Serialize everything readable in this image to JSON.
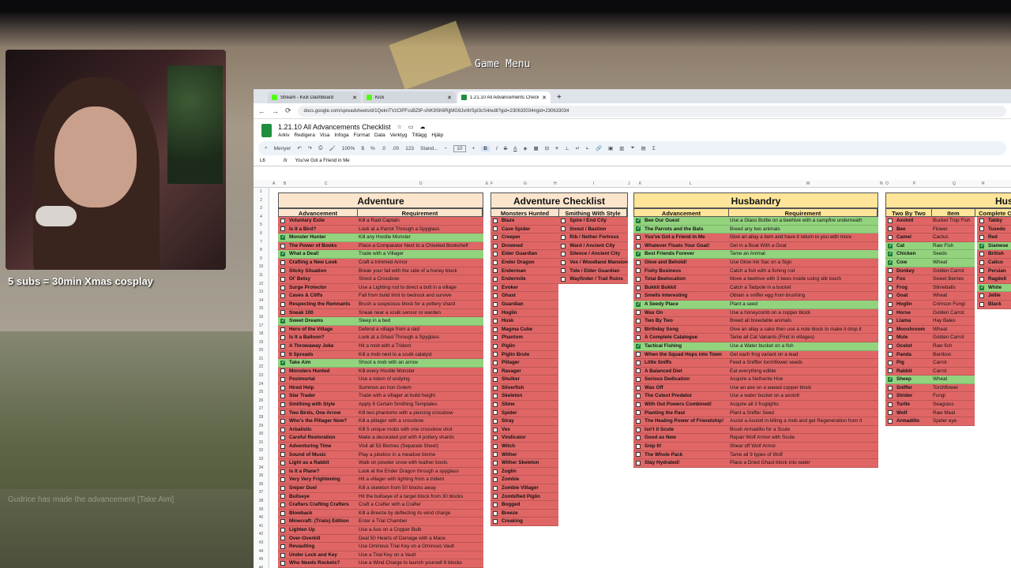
{
  "overlay": {
    "game_menu": "Game Menu",
    "cosplay": "5 subs = 30min Xmas cosplay",
    "chat": "Gudrice has made the advancement [Take Aim]"
  },
  "browser": {
    "tabs": [
      {
        "label": "Stream - Kick Dashboard"
      },
      {
        "label": "Kick"
      },
      {
        "label": "1.21.10 All Advancements Checklist"
      }
    ],
    "new_tab": "+",
    "url": "docs.google.com/spreadsheets/d/1QeknTVzClPFssBZtP-sNK9SK6RjjMG9Jvr8rSpI3cS4/edit?gid=230633034#gid=230633034"
  },
  "doc": {
    "title": "1.21.10 All Advancements Checklist",
    "menus": [
      "Arkiv",
      "Redigera",
      "Visa",
      "Infoga",
      "Format",
      "Data",
      "Verktyg",
      "Tillägg",
      "Hjälp"
    ],
    "toolbar": {
      "menus": "Menyer",
      "zoom": "100%",
      "currency": "$",
      "percent": "%",
      "decimals": ".0",
      "decimals2": ".00",
      "num123": "123",
      "font": "Stand...",
      "fontsize": "10",
      "bold": "B",
      "italic": "I",
      "strike": "S",
      "textcolor": "A"
    },
    "formula": {
      "cell": "L6",
      "value": "You've Got a Friend in Me"
    }
  },
  "columns": [
    "A",
    "B",
    "C",
    "D",
    "E",
    "F",
    "G",
    "H",
    "I",
    "J",
    "K",
    "L",
    "M",
    "N",
    "O",
    "P",
    "Q",
    "R"
  ],
  "rows": [
    "1",
    "2",
    "3",
    "4",
    "5",
    "6",
    "7",
    "8",
    "9",
    "10",
    "11",
    "12",
    "13",
    "14",
    "15",
    "16",
    "17",
    "18",
    "19",
    "20",
    "21",
    "22",
    "23",
    "24",
    "25",
    "26",
    "27",
    "28",
    "29",
    "30",
    "31",
    "32",
    "33",
    "34",
    "35",
    "36",
    "37",
    "38",
    "39",
    "40",
    "41",
    "42",
    "43",
    "44",
    "45",
    "46"
  ],
  "adventure": {
    "title": "Adventure",
    "h1": "Advancement",
    "h2": "Requirement",
    "rows": [
      [
        "Voluntary Exile",
        "Kill a Raid Captain",
        false
      ],
      [
        "Is It a Bird?",
        "Look at a Parrot Through a Spyglass",
        false
      ],
      [
        "Monster Hunter",
        "Kill any Hostile Monster",
        true
      ],
      [
        "The Power of Books",
        "Place a Comparator Next to a Chiseled Bookshelf",
        false
      ],
      [
        "What a Deal!",
        "Trade with a Villager",
        true
      ],
      [
        "Crafting a New Look",
        "Craft a trimmed Armor",
        false
      ],
      [
        "Sticky Situation",
        "Break your fall with the side of a honey block",
        false
      ],
      [
        "Ol' Betsy",
        "Shoot a Crossbow",
        false
      ],
      [
        "Surge Protector",
        "Use a Lighting rod to direct a bolt in a village",
        false
      ],
      [
        "Caves & Cliffs",
        "Fall from build limit to bedrock and survive",
        false
      ],
      [
        "Respecting the Remnants",
        "Brush a suspicious block for a pottery shard",
        false
      ],
      [
        "Sneak 100",
        "Sneak near a sculk sensor or warden",
        false
      ],
      [
        "Sweet Dreams",
        "Sleep in a bed",
        true
      ],
      [
        "Hero of the Village",
        "Defend a village from a raid",
        false
      ],
      [
        "Is It a Balloon?",
        "Look at a Ghast Through a Spyglass",
        false
      ],
      [
        "A Throwaway Joke",
        "Hit a mob with a Trident",
        false
      ],
      [
        "It Spreads",
        "Kill a mob next to a sculk catalyst",
        false
      ],
      [
        "Take Aim",
        "Shoot a mob with an arrow",
        true
      ],
      [
        "Monsters Hunted",
        "Kill every Hostile Monster",
        false
      ],
      [
        "Postmortal",
        "Use a totem of undying",
        false
      ],
      [
        "Hired Help",
        "Summon an Iron Golem",
        false
      ],
      [
        "Star Trader",
        "Trade with a villager at build height",
        false
      ],
      [
        "Smithing with Style",
        "Apply 8 Certain Smithing Templates",
        false
      ],
      [
        "Two Birds, One Arrow",
        "Kill two phantoms with a piercing crossbow",
        false
      ],
      [
        "Who's the Pillager Now?",
        "Kill a pillager with a crossbow",
        false
      ],
      [
        "Arbalistic",
        "Kill 5 unique mobs with one crossbow shot",
        false
      ],
      [
        "Careful Restoration",
        "Make a decorated pot with 4 pottery shards",
        false
      ],
      [
        "Adventuring Time",
        "Visit all 53 Biomes (Separate Sheet)",
        false
      ],
      [
        "Sound of Music",
        "Play a jukebox in a meadow biome",
        false
      ],
      [
        "Light as a Rabbit",
        "Walk on powder snow with leather boots",
        false
      ],
      [
        "Is It a Plane?",
        "Look at the Ender Dragon through a spyglass",
        false
      ],
      [
        "Very Very Frightening",
        "Hit a villager with lighting from a trident",
        false
      ],
      [
        "Sniper Duel",
        "Kill a skeleton from 50 blocks away",
        false
      ],
      [
        "Bullseye",
        "Hit the bullseye of a target block from 30 blocks",
        false
      ],
      [
        "Crafters Crafting Crafters",
        "Craft a Crafter with a Crafter",
        false
      ],
      [
        "Blowback",
        "Kill a Breeze by deflecting its wind charge",
        false
      ],
      [
        "Minecraft: (Trials) Edition",
        "Enter a Trial Chamber",
        false
      ],
      [
        "Lighten Up",
        "Use a Axe on a Copper Bulb",
        false
      ],
      [
        "Over-Overkill",
        "Deal 50 Hearts of Damage with a Mace",
        false
      ],
      [
        "Revaulting",
        "Use Ominous Trial Key on a Ominous Vault",
        false
      ],
      [
        "Under Lock and Key",
        "Use a Trial Key on a Vault",
        false
      ],
      [
        "Who Needs Rockets?",
        "Use a Wind Charge to launch yourself 8 blocks",
        false
      ]
    ]
  },
  "adventure_checklist": {
    "title": "Adventure Checklist",
    "h1": "Monsters Hunted",
    "h2": "Smithing With Style",
    "monsters": [
      "Blaze",
      "Cave Spider",
      "Creeper",
      "Drowned",
      "Elder Guardian",
      "Ender Dragon",
      "Enderman",
      "Endermite",
      "Evoker",
      "Ghast",
      "Guardian",
      "Hoglin",
      "Husk",
      "Magma Cube",
      "Phantom",
      "Piglin",
      "Piglin Brute",
      "Pillager",
      "Ravager",
      "Shulker",
      "Silverfish",
      "Skeleton",
      "Slime",
      "Spider",
      "Stray",
      "Vex",
      "Vindicator",
      "Witch",
      "Wither",
      "Wither Skeleton",
      "Zoglin",
      "Zombie",
      "Zombie Villager",
      "Zombified Piglin",
      "Bogged",
      "Breeze",
      "Creaking"
    ],
    "smithing": [
      "Spire / End City",
      "Snout / Bastion",
      "Rib / Nether Fortress",
      "Ward / Ancient City",
      "Silence / Ancient City",
      "Vex / Woodland Mansion",
      "Tide / Elder Guardian",
      "Wayfinder / Trail Ruins"
    ]
  },
  "husbandry": {
    "title": "Husbandry",
    "h1": "Advancement",
    "h2": "Requirement",
    "rows": [
      [
        "Bee Our Guest",
        "Use a Glass Bottle on a beehive with a campfire underneath",
        true
      ],
      [
        "The Parrots and the Bats",
        "Breed any two animals",
        true
      ],
      [
        "You've Got a Friend in Me",
        "Give an allay a item and have it return to you with more",
        false
      ],
      [
        "Whatever Floats Your Goat!",
        "Get in a Boat With a Goat",
        false
      ],
      [
        "Best Friends Forever",
        "Tame an Animal",
        true
      ],
      [
        "Glow and Behold!",
        "Use Glow Ink Sac on a Sign",
        false
      ],
      [
        "Fishy Business",
        "Catch a fish with a fishing rod",
        false
      ],
      [
        "Total Beelocation",
        "Move a beehive with 3 bees inside using silk touch",
        false
      ],
      [
        "Bukkit Bukkit",
        "Catch a Tadpole in a bucket",
        false
      ],
      [
        "Smells Interesting",
        "Obtain a sniffer egg from brushing",
        false
      ],
      [
        "A Seedy Place",
        "Plant a seed",
        true
      ],
      [
        "Wax On",
        "Use a honeycomb on a copper block",
        false
      ],
      [
        "Two By Two",
        "Breed all breedable animals",
        false
      ],
      [
        "Birthday Song",
        "Give an allay a cake then use a note block to make it drop it",
        false
      ],
      [
        "A Complete Catalogue",
        "Tame all Cat Variants (Find in villages)",
        false
      ],
      [
        "Tactical Fishing",
        "Use a Water bucket on a fish",
        true
      ],
      [
        "When the Squad Hops into Town",
        "Get each frog variant on a lead",
        false
      ],
      [
        "Little Sniffs",
        "Feed a Sniffler torchflower seeds",
        false
      ],
      [
        "A Balanced Diet",
        "Eat everything edible",
        false
      ],
      [
        "Serious Dedication",
        "Acquire a Netherite Hoe",
        false
      ],
      [
        "Wax Off",
        "Use an axe on a waxed copper block",
        false
      ],
      [
        "The Cutest Predator",
        "Use a water bucket on a axolotl",
        false
      ],
      [
        "With Out Powers Combined!",
        "Acquire all 3 froglights",
        false
      ],
      [
        "Planting the Past",
        "Plant a Sniffer Seed",
        false
      ],
      [
        "The Healing Power of Friendship!",
        "Assist a Axolotl in killing a mob and get Regeneration from it",
        false
      ],
      [
        "Isn't it Scute",
        "Brush Armadillo for a Scute",
        false
      ],
      [
        "Good as New",
        "Repair Wolf Armor with Scute",
        false
      ],
      [
        "Snip It!",
        "Shear off Wolf Armor",
        false
      ],
      [
        "The Whole Pack",
        "Tame all 9 types of Wolf",
        false
      ],
      [
        "Stay Hydrated!",
        "Place a Dried Ghast block into water",
        false
      ]
    ]
  },
  "husbandry2": {
    "title": "Husb",
    "h1": "Two By Two",
    "h2": "Item",
    "h3": "Complete Ca",
    "animals": [
      [
        "Axolotl",
        "Bucket Trop Fish",
        false
      ],
      [
        "Bee",
        "Flower",
        false
      ],
      [
        "Camel",
        "Cactus",
        false
      ],
      [
        "Cat",
        "Raw Fish",
        true
      ],
      [
        "Chicken",
        "Seeds",
        true
      ],
      [
        "Cow",
        "Wheat",
        true
      ],
      [
        "Donkey",
        "Golden Carrot",
        false
      ],
      [
        "Fox",
        "Sweet Berries",
        false
      ],
      [
        "Frog",
        "Slimeballs",
        false
      ],
      [
        "Goat",
        "Wheat",
        false
      ],
      [
        "Hoglin",
        "Crimson Fungi",
        false
      ],
      [
        "Horse",
        "Golden Carrot",
        false
      ],
      [
        "Llama",
        "Hay Bales",
        false
      ],
      [
        "Mooshroom",
        "Wheat",
        false
      ],
      [
        "Mule",
        "Golden Carrot",
        false
      ],
      [
        "Ocelot",
        "Raw fish",
        false
      ],
      [
        "Panda",
        "Bamboo",
        false
      ],
      [
        "Pig",
        "Carrot",
        false
      ],
      [
        "Rabbit",
        "Carrot",
        false
      ],
      [
        "Sheep",
        "Wheat",
        true
      ],
      [
        "Sniffer",
        "Torchflower",
        false
      ],
      [
        "Strider",
        "Fungi",
        false
      ],
      [
        "Turtle",
        "Seagrass",
        false
      ],
      [
        "Wolf",
        "Raw Meat",
        false
      ],
      [
        "Armadillo",
        "Spider eye",
        false
      ]
    ],
    "cats": [
      [
        "Tabby",
        false
      ],
      [
        "Tuxedo",
        false
      ],
      [
        "Red",
        false
      ],
      [
        "Siamese",
        true
      ],
      [
        "British",
        false
      ],
      [
        "Calico",
        false
      ],
      [
        "Persian",
        false
      ],
      [
        "Ragdoll",
        false
      ],
      [
        "White",
        true
      ],
      [
        "Jellie",
        false
      ],
      [
        "Black",
        false
      ]
    ]
  },
  "colors": {
    "red": "#e06666",
    "green": "#93d37e",
    "adventure_header": "#fce5cd",
    "husbandry_header": "#ffe599"
  }
}
